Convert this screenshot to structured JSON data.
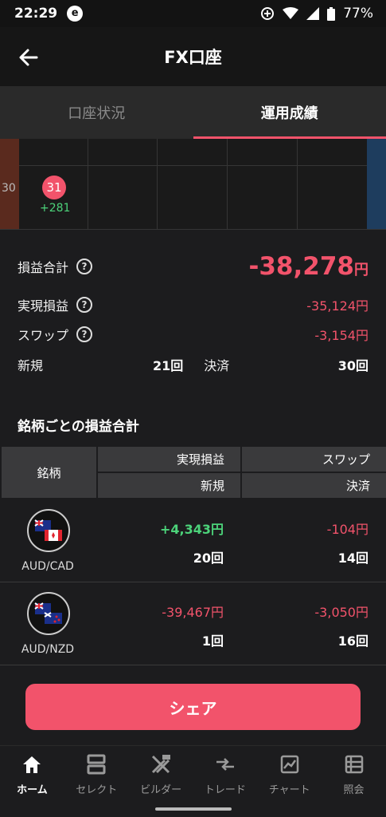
{
  "status_bar": {
    "time": "22:29",
    "app_icon": "e",
    "battery": "77%"
  },
  "header": {
    "title": "FX口座"
  },
  "tabs": [
    {
      "label": "口座状況"
    },
    {
      "label": "運用成績"
    }
  ],
  "calendar": {
    "prev_day": "30",
    "day": "31",
    "day_value": "+281"
  },
  "summary": {
    "total_label": "損益合計",
    "total_value": "-38,278",
    "total_unit": "円",
    "realized_label": "実現損益",
    "realized_value": "-35,124円",
    "swap_label": "スワップ",
    "swap_value": "-3,154円",
    "new_label": "新規",
    "new_value": "21回",
    "settle_label": "決済",
    "settle_value": "30回",
    "help_glyph": "?"
  },
  "section_title": "銘柄ごとの損益合計",
  "table": {
    "headers": {
      "name": "銘柄",
      "realized": "実現損益",
      "swap": "スワップ",
      "new": "新規",
      "settle": "決済"
    },
    "rows": [
      {
        "pair": "AUD/CAD",
        "realized": "+4,343円",
        "swap": "-104円",
        "new": "20回",
        "settle": "14回"
      },
      {
        "pair": "AUD/NZD",
        "realized": "-39,467円",
        "swap": "-3,050円",
        "new": "1回",
        "settle": "16回"
      }
    ]
  },
  "share_button": "シェア",
  "bottom_nav": [
    {
      "label": "ホーム",
      "icon": "home-icon"
    },
    {
      "label": "セレクト",
      "icon": "select-icon"
    },
    {
      "label": "ビルダー",
      "icon": "builder-icon"
    },
    {
      "label": "トレード",
      "icon": "trade-icon"
    },
    {
      "label": "チャート",
      "icon": "chart-icon"
    },
    {
      "label": "照会",
      "icon": "list-icon"
    }
  ],
  "colors": {
    "accent": "#f2536b",
    "positive": "#4cd37a",
    "background": "#1c1c1e"
  }
}
